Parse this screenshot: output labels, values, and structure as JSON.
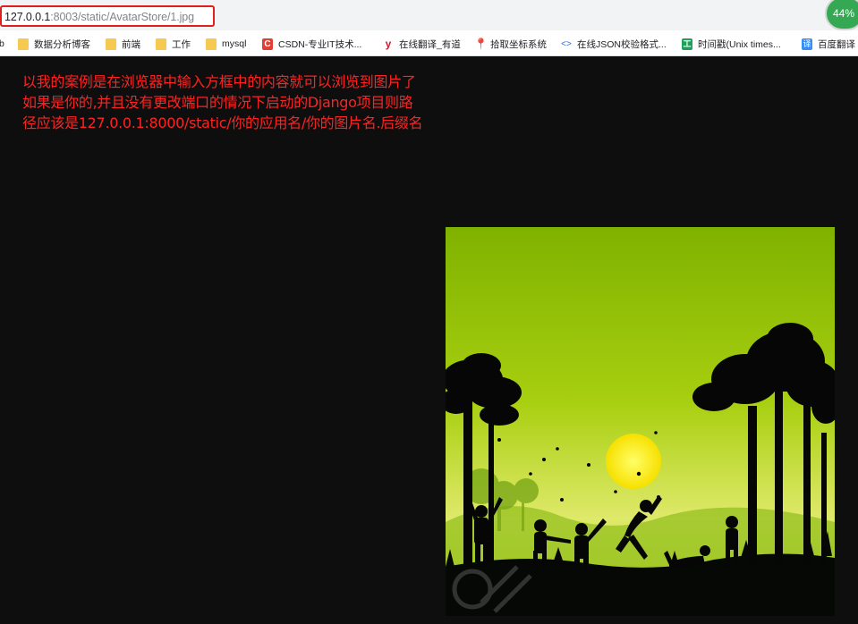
{
  "address_bar": {
    "url_host": "127.0.0.1",
    "url_path": ":8003/static/AvatarStore/1.jpg",
    "zoom_badge": "44%"
  },
  "bookmarks": [
    {
      "label": "b",
      "icon": "none"
    },
    {
      "label": "数据分析博客",
      "icon": "folder-icon"
    },
    {
      "label": "前端",
      "icon": "folder-icon"
    },
    {
      "label": "工作",
      "icon": "folder-icon"
    },
    {
      "label": "mysql",
      "icon": "folder-icon"
    },
    {
      "label": "CSDN-专业IT技术...",
      "icon": "csdn-icon",
      "glyph": "C"
    },
    {
      "label": "在线翻译_有道",
      "icon": "youdao-icon",
      "glyph": "y"
    },
    {
      "label": "拾取坐标系统",
      "icon": "map-pin-icon",
      "glyph": "📍"
    },
    {
      "label": "在线JSON校验格式...",
      "icon": "code-icon",
      "glyph": "<>"
    },
    {
      "label": "时间戳(Unix times...",
      "icon": "time-tool-icon",
      "glyph": "工"
    },
    {
      "label": "百度翻译",
      "icon": "baidu-translate-icon",
      "glyph": "译"
    }
  ],
  "annotation": {
    "line1": "以我的案例是在浏览器中输入方框中的内容就可以浏览到图片了",
    "line2": "如果是你的,并且没有更改端口的情况下启动的Django项目则路",
    "line3": "径应该是127.0.0.1:8000/static/你的应用名/你的图片名.后缀名"
  },
  "image": {
    "description_icon": "silhouette-children-sunset-image"
  },
  "colors": {
    "annotation_red": "#ff2222",
    "highlight_box": "#e0201b",
    "page_background": "#0e0e0e"
  }
}
